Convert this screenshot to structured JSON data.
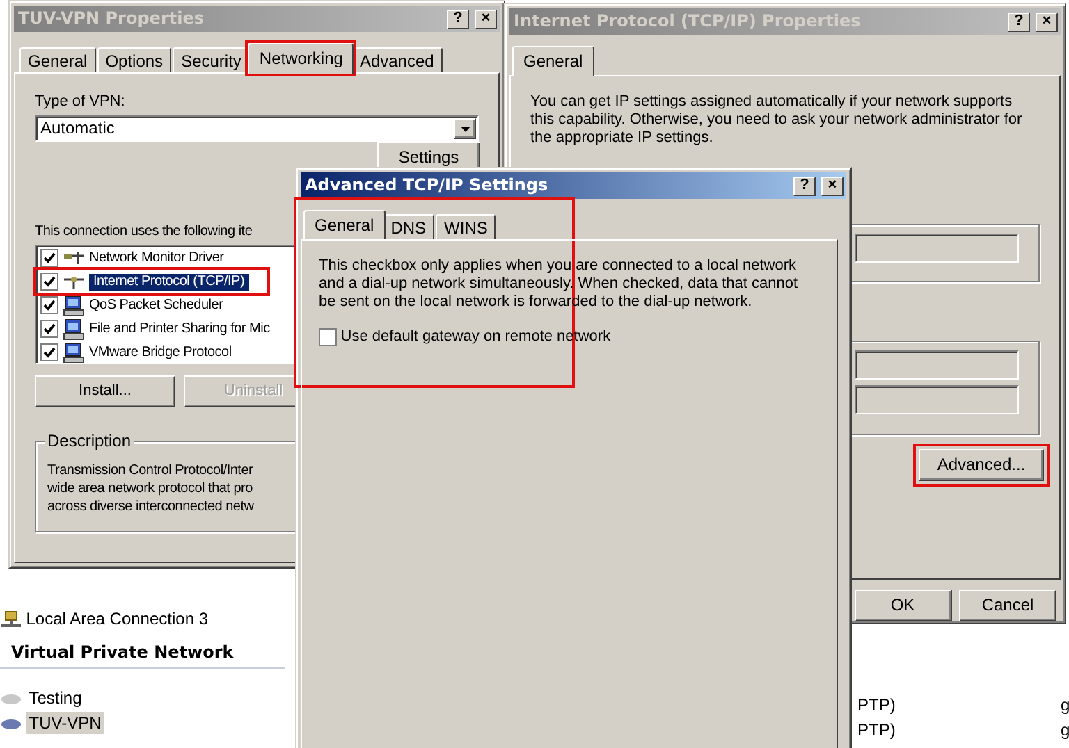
{
  "background": {
    "connections": [
      {
        "label": "Local Area Connection 3",
        "selected": false
      }
    ],
    "section": "Virtual Private Network",
    "vpn_items": [
      {
        "label": "Testing",
        "selected": false,
        "connected": false
      },
      {
        "label": "TUV-VPN",
        "selected": true,
        "connected": true
      }
    ],
    "column_2": [
      "PTP)",
      "PTP)"
    ],
    "column_3": [
      "g",
      "g"
    ]
  },
  "vpn_properties": {
    "title": "TUV-VPN Properties",
    "active": false,
    "title_buttons": [
      "?",
      "×"
    ],
    "tabs": [
      {
        "label": "General",
        "selected": false,
        "highlighted": false
      },
      {
        "label": "Options",
        "selected": false,
        "highlighted": false
      },
      {
        "label": "Security",
        "selected": false,
        "highlighted": false
      },
      {
        "label": "Networking",
        "selected": true,
        "highlighted": true
      },
      {
        "label": "Advanced",
        "selected": false,
        "highlighted": false
      }
    ],
    "type_label": "Type of VPN:",
    "type_value": "Automatic",
    "settings_button": "Settings",
    "items_label": "This connection uses the following ite",
    "components": [
      {
        "label": "Network Monitor Driver",
        "kind": "driver",
        "checked": true,
        "selected": false,
        "highlighted": false
      },
      {
        "label": "Internet Protocol (TCP/IP)",
        "kind": "protocol",
        "checked": true,
        "selected": true,
        "highlighted": true
      },
      {
        "label": "QoS Packet Scheduler",
        "kind": "service",
        "checked": true,
        "selected": false,
        "highlighted": false
      },
      {
        "label": "File and Printer Sharing for Mic",
        "kind": "service",
        "checked": true,
        "selected": false,
        "highlighted": false
      },
      {
        "label": "VMware Bridge Protocol",
        "kind": "service",
        "checked": true,
        "selected": false,
        "highlighted": false
      }
    ],
    "buttons": [
      {
        "label": "Install...",
        "disabled": false
      },
      {
        "label": "Uninstall",
        "disabled": true
      }
    ],
    "description": {
      "legend": "Description",
      "lines": [
        "Transmission Control Protocol/Inter",
        "wide area network protocol that pro",
        "across diverse interconnected netw"
      ]
    }
  },
  "tcpip_properties": {
    "title": "Internet Protocol (TCP/IP) Properties",
    "active": false,
    "title_buttons": [
      "?",
      "×"
    ],
    "tabs": [
      {
        "label": "General",
        "selected": true
      }
    ],
    "intro": "You can get IP settings assigned automatically if your network supports this capability. Otherwise, you need to ask your network administrator for the appropriate IP settings.",
    "advanced_button": {
      "label": "Advanced...",
      "highlighted": true
    },
    "buttons": [
      "OK",
      "Cancel"
    ]
  },
  "advanced_dialog": {
    "title": "Advanced TCP/IP Settings",
    "active": true,
    "highlighted": true,
    "title_buttons": [
      "?",
      "×"
    ],
    "tabs": [
      {
        "label": "General",
        "selected": true
      },
      {
        "label": "DNS",
        "selected": false
      },
      {
        "label": "WINS",
        "selected": false
      }
    ],
    "note": "This checkbox only applies when you are connected to a local network and a dial-up network simultaneously.  When checked, data that cannot be sent on the local network is forwarded to the dial-up network.",
    "options": [
      {
        "label": "Use default gateway on remote network",
        "checked": false
      }
    ]
  }
}
